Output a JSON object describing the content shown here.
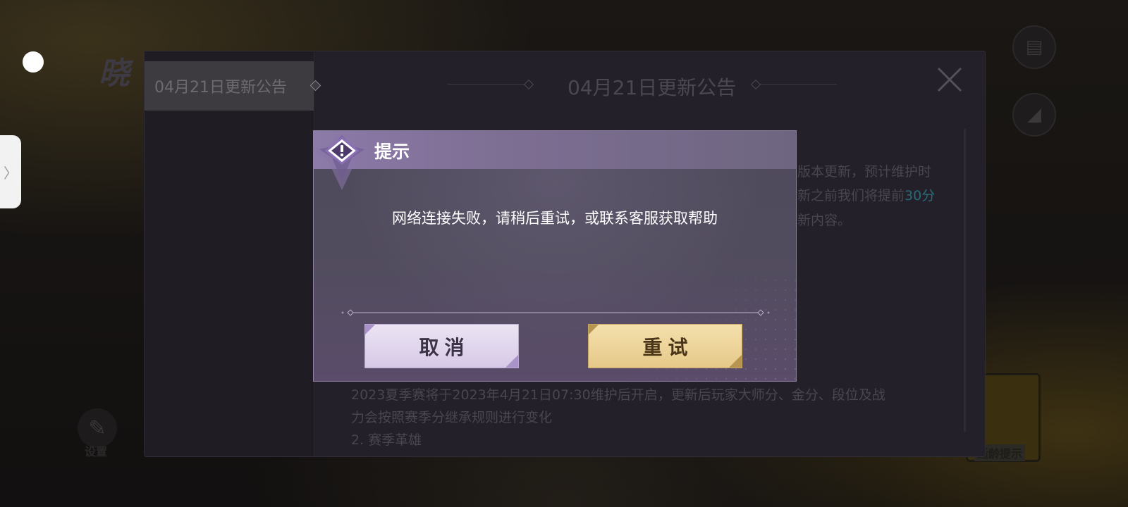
{
  "background": {
    "title_fragment": "晓",
    "settings_label": "设置",
    "age_hint": "适龄提示"
  },
  "announcement": {
    "tab_label": "04月21日更新公告",
    "header_title": "04月21日更新公告",
    "lines_right": [
      "版本更新，预计维护时",
      "新之前我们将提前",
      "新内容。"
    ],
    "highlight": "30分",
    "bottom_lines": [
      "2023夏季赛将于2023年4月21日07:30维护后开启，更新后玩家大师分、金分、段位及战",
      "力会按照赛季分继承规则进行变化",
      "2. 赛季革雄"
    ]
  },
  "modal": {
    "title": "提示",
    "message": "网络连接失败，请稍后重试，或联系客服获取帮助",
    "cancel_label": "取消",
    "retry_label": "重试"
  },
  "colors": {
    "modal_header": "#8c7aa8",
    "cancel_bg": "#ece4f4",
    "retry_bg": "#f4e0ac",
    "highlight": "#2a6a78"
  }
}
